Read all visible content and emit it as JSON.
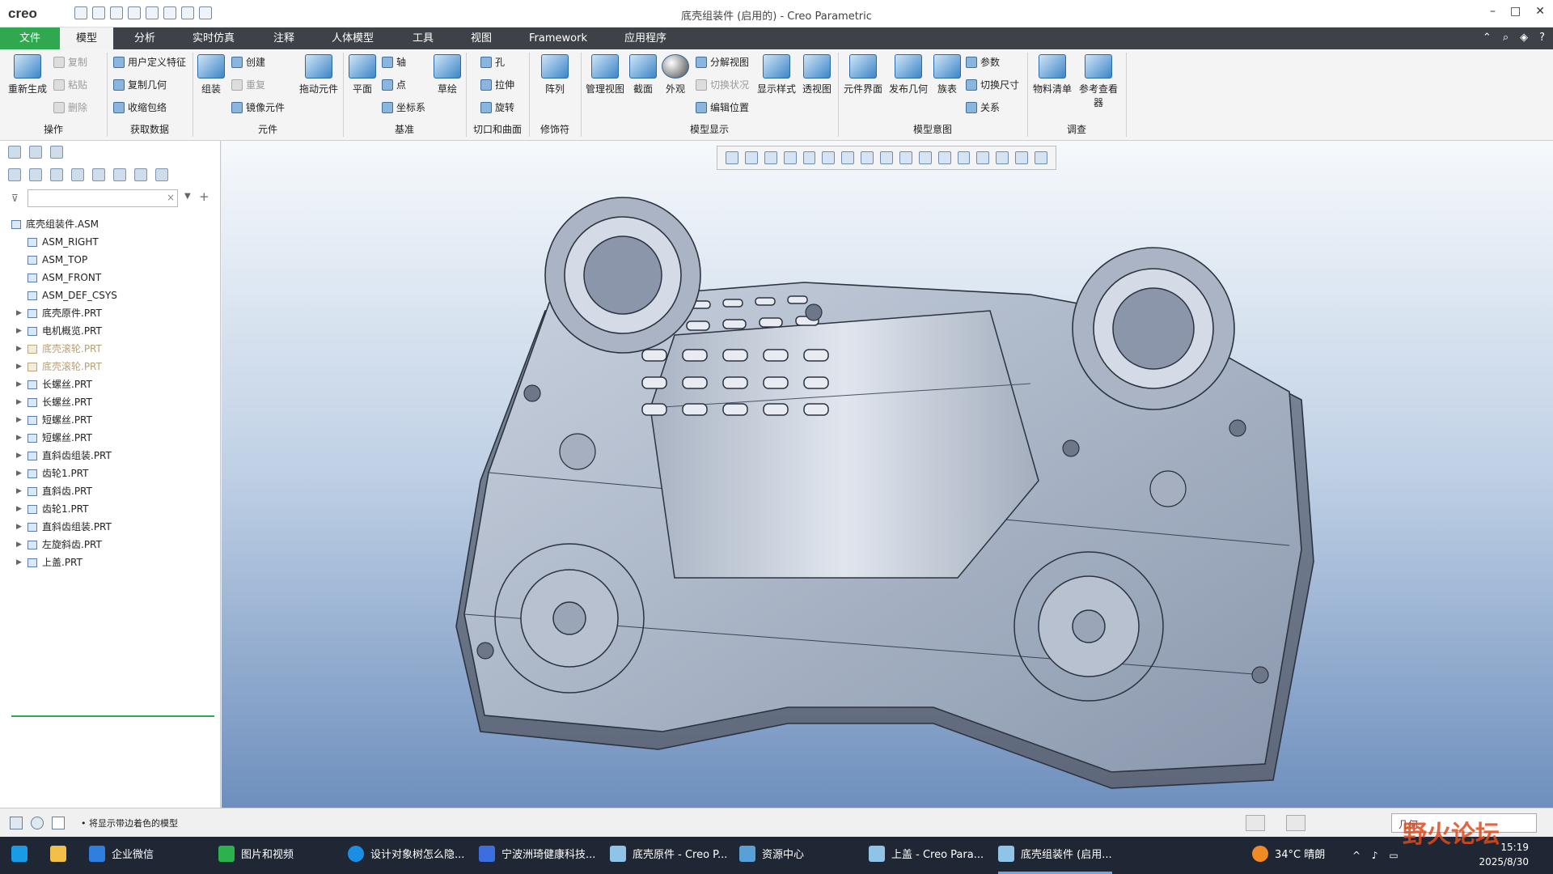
{
  "window": {
    "logo": "creo",
    "title": "底壳组装件 (启用的) - Creo Parametric"
  },
  "tabs": [
    {
      "label": "文件"
    },
    {
      "label": "模型"
    },
    {
      "label": "分析"
    },
    {
      "label": "实时仿真"
    },
    {
      "label": "注释"
    },
    {
      "label": "人体模型"
    },
    {
      "label": "工具"
    },
    {
      "label": "视图"
    },
    {
      "label": "Framework"
    },
    {
      "label": "应用程序"
    }
  ],
  "ribbon": {
    "regenerate": "重新生成",
    "copy": "复制",
    "paste": "粘贴",
    "delete": "删除",
    "user_feature": "用户定义特征",
    "copy_geom": "复制几何",
    "shrinkwrap": "收缩包络",
    "assemble": "组装",
    "create": "创建",
    "repeat": "重复",
    "mirror": "镜像元件",
    "drag": "拖动元件",
    "plane": "平面",
    "axis": "轴",
    "point": "点",
    "csys": "坐标系",
    "sketch": "草绘",
    "hole": "孔",
    "extrude": "拉伸",
    "revolve": "旋转",
    "pattern": "阵列",
    "manage_views": "管理视图",
    "section": "截面",
    "appearance": "外观",
    "explode": "分解视图",
    "toggle_status": "切换状况",
    "edit_position": "编辑位置",
    "display_style": "显示样式",
    "perspective": "透视图",
    "component_interface": "元件界面",
    "publish_geom": "发布几何",
    "family_table": "族表",
    "parameters": "参数",
    "switch_dims": "切换尺寸",
    "relations": "关系",
    "bom": "物料清单",
    "ref_viewer": "参考查看器",
    "groups": {
      "operations": "操作",
      "get_data": "获取数据",
      "component": "元件",
      "datum": "基准",
      "cut_surface": "切口和曲面",
      "modifiers": "修饰符",
      "model_display": "模型显示",
      "model_intent": "模型意图",
      "investigate": "调查"
    }
  },
  "tree": [
    {
      "label": "底壳组装件.ASM",
      "level": 0,
      "expand": false,
      "dim": false
    },
    {
      "label": "ASM_RIGHT",
      "level": 1,
      "expand": false,
      "dim": false
    },
    {
      "label": "ASM_TOP",
      "level": 1,
      "expand": false,
      "dim": false
    },
    {
      "label": "ASM_FRONT",
      "level": 1,
      "expand": false,
      "dim": false
    },
    {
      "label": "ASM_DEF_CSYS",
      "level": 1,
      "expand": false,
      "dim": false
    },
    {
      "label": "底壳原件.PRT",
      "level": 1,
      "expand": true,
      "dim": false
    },
    {
      "label": "电机概览.PRT",
      "level": 1,
      "expand": true,
      "dim": false
    },
    {
      "label": "底壳滚轮.PRT",
      "level": 1,
      "expand": true,
      "dim": true
    },
    {
      "label": "底壳滚轮.PRT",
      "level": 1,
      "expand": true,
      "dim": true
    },
    {
      "label": "长螺丝.PRT",
      "level": 1,
      "expand": true,
      "dim": false
    },
    {
      "label": "长螺丝.PRT",
      "level": 1,
      "expand": true,
      "dim": false
    },
    {
      "label": "短螺丝.PRT",
      "level": 1,
      "expand": true,
      "dim": false
    },
    {
      "label": "短螺丝.PRT",
      "level": 1,
      "expand": true,
      "dim": false
    },
    {
      "label": "直斜齿组装.PRT",
      "level": 1,
      "expand": true,
      "dim": false
    },
    {
      "label": "齿轮1.PRT",
      "level": 1,
      "expand": true,
      "dim": false
    },
    {
      "label": "直斜齿.PRT",
      "level": 1,
      "expand": true,
      "dim": false
    },
    {
      "label": "齿轮1.PRT",
      "level": 1,
      "expand": true,
      "dim": false
    },
    {
      "label": "直斜齿组装.PRT",
      "level": 1,
      "expand": true,
      "dim": false
    },
    {
      "label": "左旋斜齿.PRT",
      "level": 1,
      "expand": true,
      "dim": false
    },
    {
      "label": "上盖.PRT",
      "level": 1,
      "expand": true,
      "dim": false
    }
  ],
  "status": {
    "message": "将显示带边着色的模型",
    "selection_filter": "几何"
  },
  "taskbar": [
    {
      "label": "企业微信",
      "color": "#2f7fe0"
    },
    {
      "label": "图片和视频",
      "color": "#2bb24c"
    },
    {
      "label": "设计对象树怎么隐...",
      "color": "#1a8fe3"
    },
    {
      "label": "宁波洲琦健康科技...",
      "color": "#3c6ee0"
    },
    {
      "label": "底壳原件 - Creo P...",
      "color": "#8fc3e8"
    },
    {
      "label": "资源中心",
      "color": "#5aa0d8"
    },
    {
      "label": "上盖 - Creo Para...",
      "color": "#8fc3e8"
    },
    {
      "label": "底壳组装件 (启用...",
      "color": "#8fc3e8"
    }
  ],
  "tray": {
    "weather": "34°C 晴朗",
    "time": "15:19",
    "date": "2025/8/30",
    "watermark": "野火论坛"
  }
}
